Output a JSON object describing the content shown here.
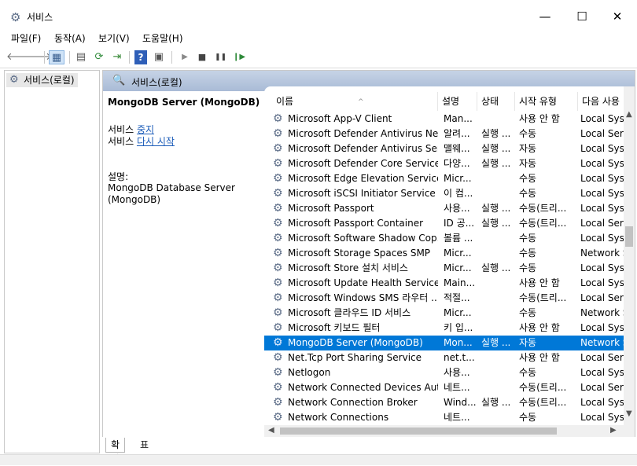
{
  "window": {
    "title": "서비스",
    "minimize": "—",
    "maximize": "☐",
    "close": "✕"
  },
  "menu": [
    "파일(F)",
    "동작(A)",
    "보기(V)",
    "도움말(H)"
  ],
  "toolbar": {
    "back": "🡐",
    "forward": "🡒",
    "tree": "▦",
    "properties": "▤",
    "refresh": "⟳",
    "export": "⇥",
    "help": "?",
    "console": "▣",
    "play": "▶",
    "stop": "■",
    "pause": "❚❚",
    "resume": "❙▶"
  },
  "tree": {
    "root_label": "서비스(로컬)"
  },
  "panel": {
    "header": "서비스(로컬)"
  },
  "description": {
    "service_title": "MongoDB Server (MongoDB)",
    "action1_prefix": "서비스 ",
    "action1_link": "중지",
    "action2_prefix": "서비스 ",
    "action2_link": "다시 시작",
    "desc_label": "설명:",
    "desc_line1": "MongoDB Database Server",
    "desc_line2": "(MongoDB)"
  },
  "columns": {
    "name": "이름",
    "desc": "설명",
    "status": "상태",
    "start_type": "시작 유형",
    "logon": "다음 사용",
    "sort_indicator": "^"
  },
  "services": [
    {
      "name": "Microsoft App-V Client",
      "desc": "Man...",
      "status": "",
      "start": "사용 안 함",
      "logon": "Local Syst"
    },
    {
      "name": "Microsoft Defender Antivirus Net...",
      "desc": "알려...",
      "status": "실행 ...",
      "start": "수동",
      "logon": "Local Serv"
    },
    {
      "name": "Microsoft Defender Antivirus Ser...",
      "desc": "맬웨...",
      "status": "실행 ...",
      "start": "자동",
      "logon": "Local Syst"
    },
    {
      "name": "Microsoft Defender Core Service",
      "desc": "다양...",
      "status": "실행 ...",
      "start": "자동",
      "logon": "Local Syst"
    },
    {
      "name": "Microsoft Edge Elevation Service ...",
      "desc": "Micr...",
      "status": "",
      "start": "수동",
      "logon": "Local Syst"
    },
    {
      "name": "Microsoft iSCSI Initiator Service",
      "desc": "이 컴...",
      "status": "",
      "start": "수동",
      "logon": "Local Syst"
    },
    {
      "name": "Microsoft Passport",
      "desc": "사용...",
      "status": "실행 ...",
      "start": "수동(트리...",
      "logon": "Local Syst"
    },
    {
      "name": "Microsoft Passport Container",
      "desc": "ID 공...",
      "status": "실행 ...",
      "start": "수동(트리...",
      "logon": "Local Serv"
    },
    {
      "name": "Microsoft Software Shadow Cop...",
      "desc": "볼륨 ...",
      "status": "",
      "start": "수동",
      "logon": "Local Syst"
    },
    {
      "name": "Microsoft Storage Spaces SMP",
      "desc": "Micr...",
      "status": "",
      "start": "수동",
      "logon": "Network S"
    },
    {
      "name": "Microsoft Store 설치 서비스",
      "desc": "Micr...",
      "status": "실행 ...",
      "start": "수동",
      "logon": "Local Syst"
    },
    {
      "name": "Microsoft Update Health Service",
      "desc": "Main...",
      "status": "",
      "start": "사용 안 함",
      "logon": "Local Syst"
    },
    {
      "name": "Microsoft Windows SMS 라우터 ...",
      "desc": "적절...",
      "status": "",
      "start": "수동(트리...",
      "logon": "Local Serv"
    },
    {
      "name": "Microsoft 클라우드 ID 서비스",
      "desc": "Micr...",
      "status": "",
      "start": "수동",
      "logon": "Network S"
    },
    {
      "name": "Microsoft 키보드 필터",
      "desc": "키 입...",
      "status": "",
      "start": "사용 안 함",
      "logon": "Local Syst"
    },
    {
      "name": "MongoDB Server (MongoDB)",
      "desc": "Mon...",
      "status": "실행 ...",
      "start": "자동",
      "logon": "Network S",
      "selected": true
    },
    {
      "name": "Net.Tcp Port Sharing Service",
      "desc": "net.t...",
      "status": "",
      "start": "사용 안 함",
      "logon": "Local Serv"
    },
    {
      "name": "Netlogon",
      "desc": "사용...",
      "status": "",
      "start": "수동",
      "logon": "Local Syst"
    },
    {
      "name": "Network Connected Devices Aut...",
      "desc": "네트...",
      "status": "",
      "start": "수동(트리...",
      "logon": "Local Serv"
    },
    {
      "name": "Network Connection Broker",
      "desc": "Wind...",
      "status": "실행 ...",
      "start": "수동(트리...",
      "logon": "Local Syst"
    },
    {
      "name": "Network Connections",
      "desc": "네트...",
      "status": "",
      "start": "수동",
      "logon": "Local Syst"
    }
  ],
  "tabs": {
    "extended": "확장",
    "standard": "표준"
  }
}
